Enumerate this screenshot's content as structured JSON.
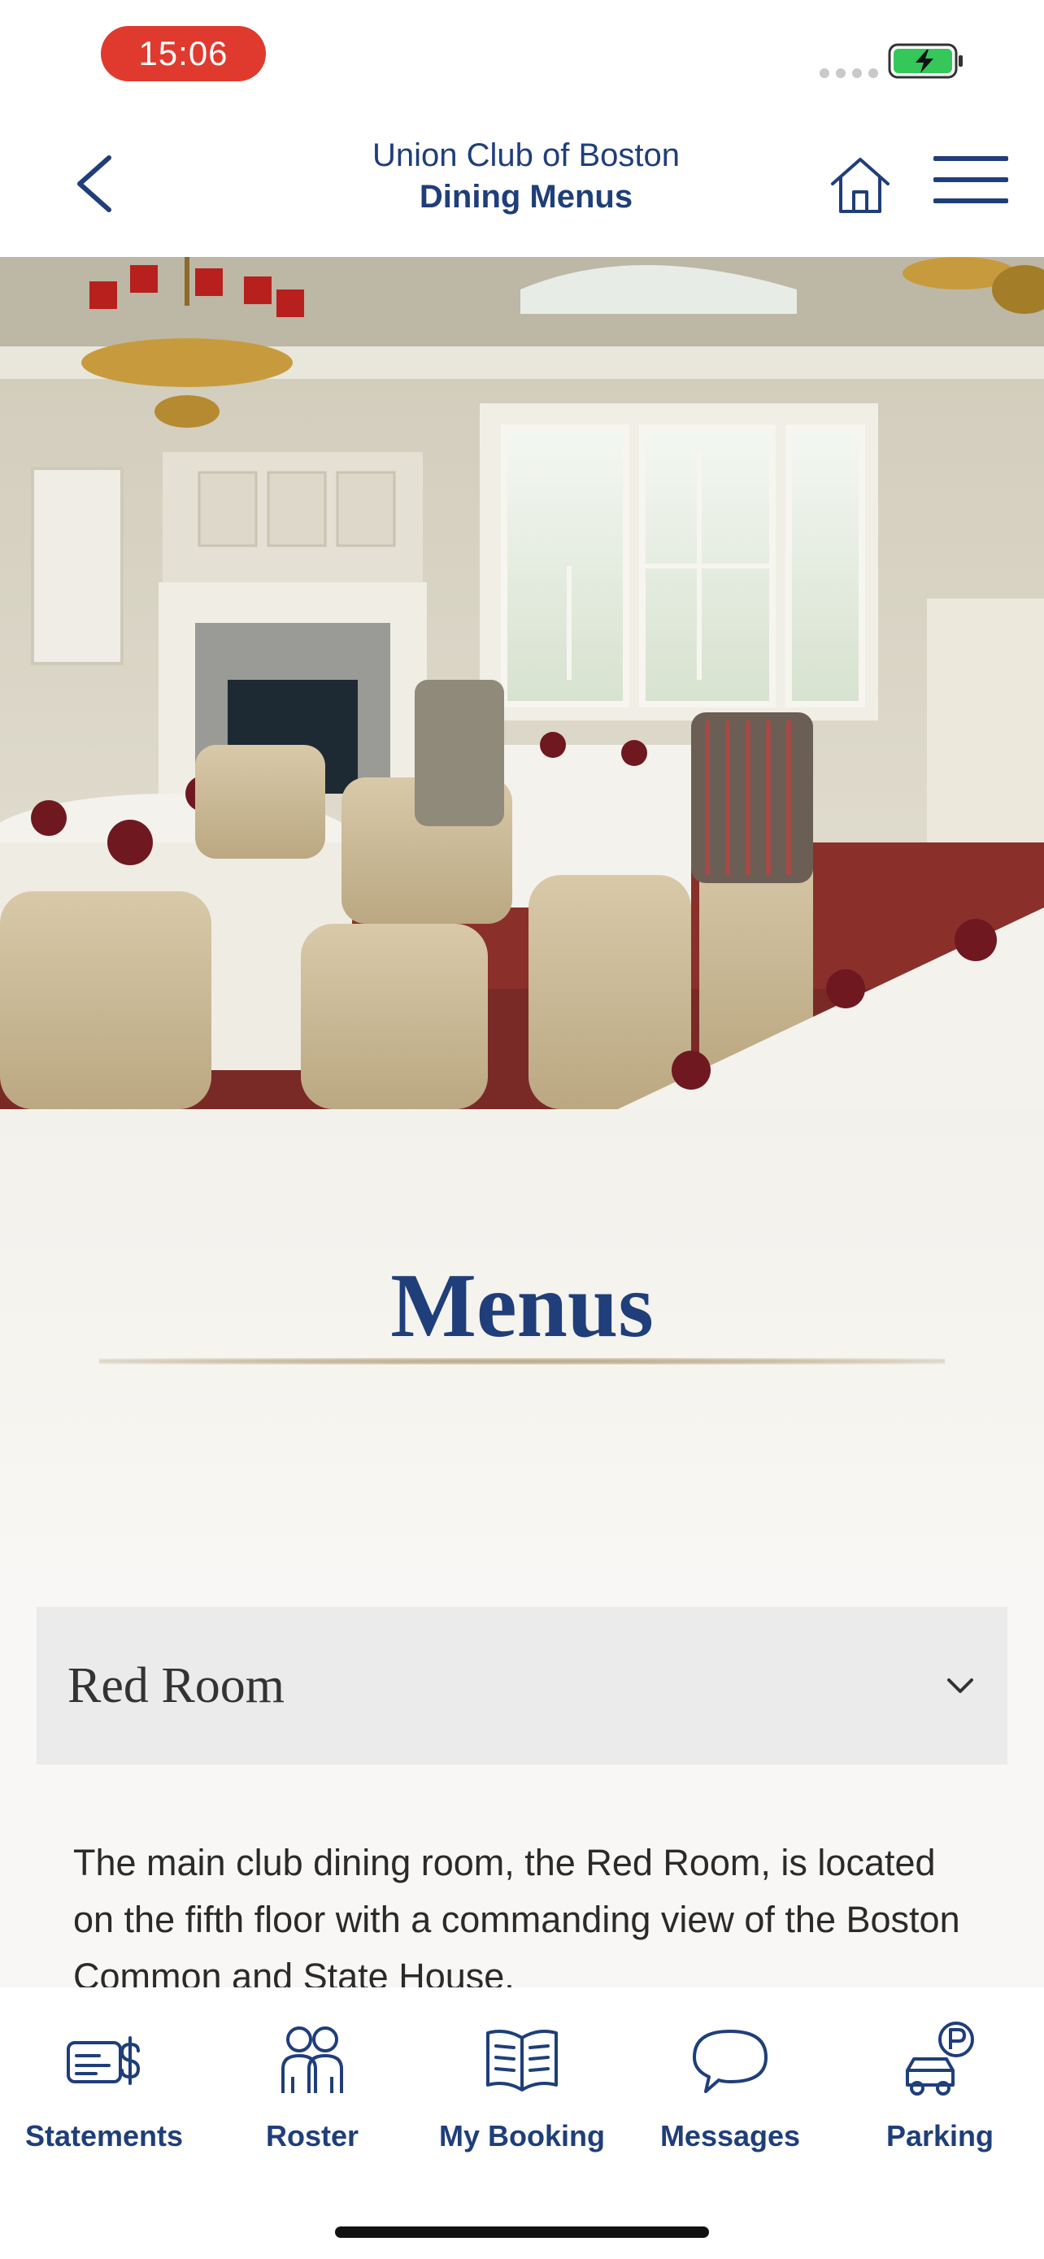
{
  "status_bar": {
    "time": "15:06"
  },
  "header": {
    "club_name": "Union Club of Boston",
    "page_name": "Dining Menus",
    "icons": {
      "back": "chevron-left-icon",
      "home": "home-icon",
      "menu": "hamburger-menu-icon"
    }
  },
  "hero": {
    "icon": "dining-room-photo"
  },
  "section": {
    "title": "Menus"
  },
  "accordion": {
    "label": "Red Room",
    "icon": "chevron-down-icon"
  },
  "description": "The main club dining room, the Red Room, is located on the fifth floor with a commanding view of the Boston Common and State House.",
  "tabs": [
    {
      "label": "Statements",
      "icon": "statement-dollar-icon"
    },
    {
      "label": "Roster",
      "icon": "people-icon"
    },
    {
      "label": "My Booking",
      "icon": "open-book-icon"
    },
    {
      "label": "Messages",
      "icon": "chat-bubble-icon"
    },
    {
      "label": "Parking",
      "icon": "car-parking-icon"
    }
  ],
  "colors": {
    "brand_blue": "#1f3e7a",
    "status_red": "#e03a2e",
    "battery_green": "#35c759"
  }
}
